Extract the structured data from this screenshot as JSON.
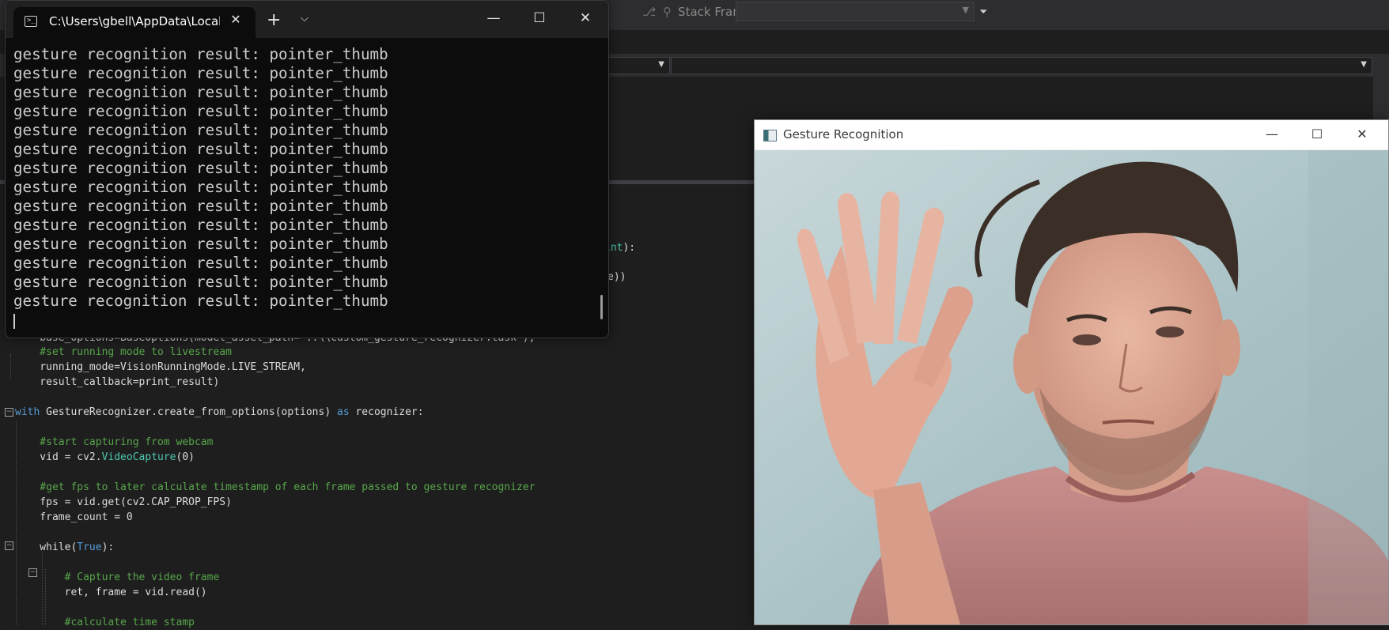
{
  "ide": {
    "stack_frame_label": "Stack Frame:",
    "stack_frame_value": "",
    "code_lines": [
      {
        "row": "a",
        "parts": [
          {
            "t": "int",
            "c": "c-teal"
          },
          {
            "t": "):",
            "c": ""
          }
        ]
      },
      {
        "row": "b",
        "parts": [
          {
            "t": "e))",
            "c": ""
          }
        ]
      },
      {
        "row": "c",
        "parts": [
          {
            "t": "    base_options=BaseOptions(model_asset_path='..\\\\custom_gesture_recognizer.task'),",
            "c": ""
          }
        ]
      },
      {
        "row": "d",
        "parts": [
          {
            "t": "    #set running mode to livestream",
            "c": "c-green"
          }
        ]
      },
      {
        "row": "e",
        "parts": [
          {
            "t": "    running_mode=VisionRunningMode.LIVE_STREAM,",
            "c": ""
          }
        ]
      },
      {
        "row": "f",
        "parts": [
          {
            "t": "    result_callback=print_result)",
            "c": ""
          }
        ]
      },
      {
        "row": "g",
        "parts": [
          {
            "t": "with",
            "c": "c-kw"
          },
          {
            "t": " GestureRecognizer.create_from_options(options) ",
            "c": ""
          },
          {
            "t": "as",
            "c": "c-kw"
          },
          {
            "t": " recognizer:",
            "c": ""
          }
        ]
      },
      {
        "row": "h",
        "parts": [
          {
            "t": "    #start capturing from webcam",
            "c": "c-green"
          }
        ]
      },
      {
        "row": "i",
        "parts": [
          {
            "t": "    vid = cv2.",
            "c": ""
          },
          {
            "t": "VideoCapture",
            "c": "c-teal"
          },
          {
            "t": "(0)",
            "c": ""
          }
        ]
      },
      {
        "row": "j",
        "parts": [
          {
            "t": "    #get fps to later calculate timestamp of each frame passed to gesture recognizer",
            "c": "c-green"
          }
        ]
      },
      {
        "row": "k",
        "parts": [
          {
            "t": "    fps = vid.get(cv2.CAP_PROP_FPS)",
            "c": ""
          }
        ]
      },
      {
        "row": "l",
        "parts": [
          {
            "t": "    frame_count = 0",
            "c": ""
          }
        ]
      },
      {
        "row": "m",
        "parts": [
          {
            "t": "    while",
            "c": ""
          },
          {
            "t": "(",
            "c": ""
          },
          {
            "t": "True",
            "c": "c-kw"
          },
          {
            "t": "):",
            "c": ""
          }
        ]
      },
      {
        "row": "n",
        "parts": [
          {
            "t": "        # Capture the video frame",
            "c": "c-green"
          }
        ]
      },
      {
        "row": "o",
        "parts": [
          {
            "t": "        ret, frame = vid.read()",
            "c": ""
          }
        ]
      },
      {
        "row": "p",
        "parts": [
          {
            "t": "        #calculate time stamp",
            "c": "c-green"
          }
        ]
      }
    ]
  },
  "terminal": {
    "tab_title": "C:\\Users\\gbell\\AppData\\Local",
    "lines": [
      "gesture recognition result: pointer_thumb",
      "gesture recognition result: pointer_thumb",
      "gesture recognition result: pointer_thumb",
      "gesture recognition result: pointer_thumb",
      "gesture recognition result: pointer_thumb",
      "gesture recognition result: pointer_thumb",
      "gesture recognition result: pointer_thumb",
      "gesture recognition result: pointer_thumb",
      "gesture recognition result: pointer_thumb",
      "gesture recognition result: pointer_thumb",
      "gesture recognition result: pointer_thumb",
      "gesture recognition result: pointer_thumb",
      "gesture recognition result: pointer_thumb",
      "gesture recognition result: pointer_thumb"
    ],
    "icons": {
      "tab": "terminal-icon",
      "close": "close-icon",
      "new_tab": "plus-icon",
      "dropdown": "chevron-down-icon",
      "minimize": "minimize-icon",
      "maximize": "maximize-icon",
      "window_close": "close-icon"
    }
  },
  "gesture_window": {
    "title": "Gesture Recognition",
    "video_description": "webcam-frame"
  }
}
